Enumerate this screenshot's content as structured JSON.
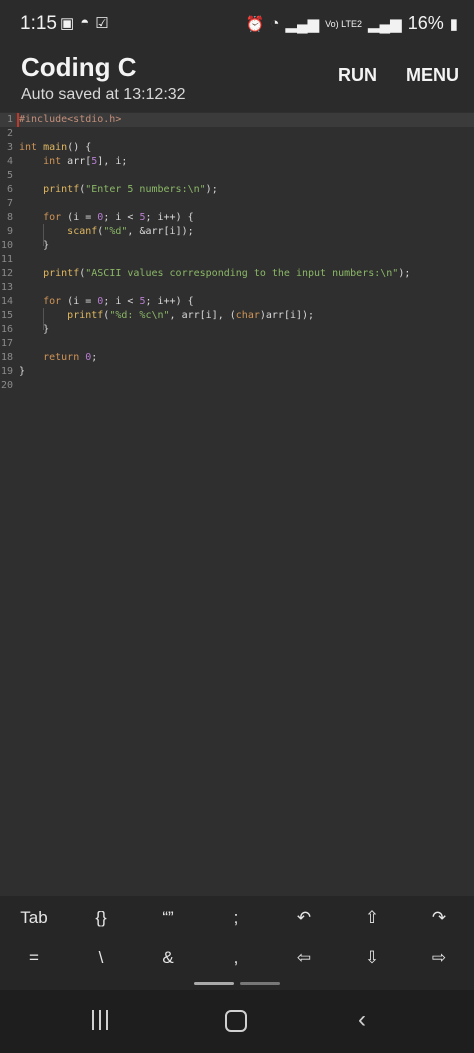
{
  "status_bar": {
    "time": "1:15",
    "network_label": "Vo) LTE2",
    "battery": "16%"
  },
  "header": {
    "title": "Coding C",
    "subtitle": "Auto saved at 13:12:32",
    "run_label": "RUN",
    "menu_label": "MENU"
  },
  "editor": {
    "line_numbers": [
      "1",
      "2",
      "3",
      "4",
      "5",
      "6",
      "7",
      "8",
      "9",
      "10",
      "11",
      "12",
      "13",
      "14",
      "15",
      "16",
      "17",
      "18",
      "19",
      "20"
    ],
    "lines": [
      "#include<stdio.h>",
      "",
      "int main() {",
      "    int arr[5], i;",
      "",
      "    printf(\"Enter 5 numbers:\\n\");",
      "",
      "    for (i = 0; i < 5; i++) {",
      "        scanf(\"%d\", &arr[i]);",
      "    }",
      "",
      "    printf(\"ASCII values corresponding to the input numbers:\\n\");",
      "",
      "    for (i = 0; i < 5; i++) {",
      "        printf(\"%d: %c\\n\", arr[i], (char)arr[i]);",
      "    }",
      "",
      "    return 0;",
      "}",
      ""
    ]
  },
  "keyboard_bar": {
    "row1": [
      "Tab",
      "{}",
      "“”",
      ";",
      "↶",
      "⇧",
      "↷"
    ],
    "row2": [
      "=",
      "\\",
      "&",
      ",",
      "⇦",
      "⇩",
      "⇨"
    ]
  },
  "colors": {
    "background": "#2f2f2f",
    "keyword": "#cf9457",
    "function": "#e0b861",
    "string": "#8bb867",
    "number": "#b77ed0"
  }
}
